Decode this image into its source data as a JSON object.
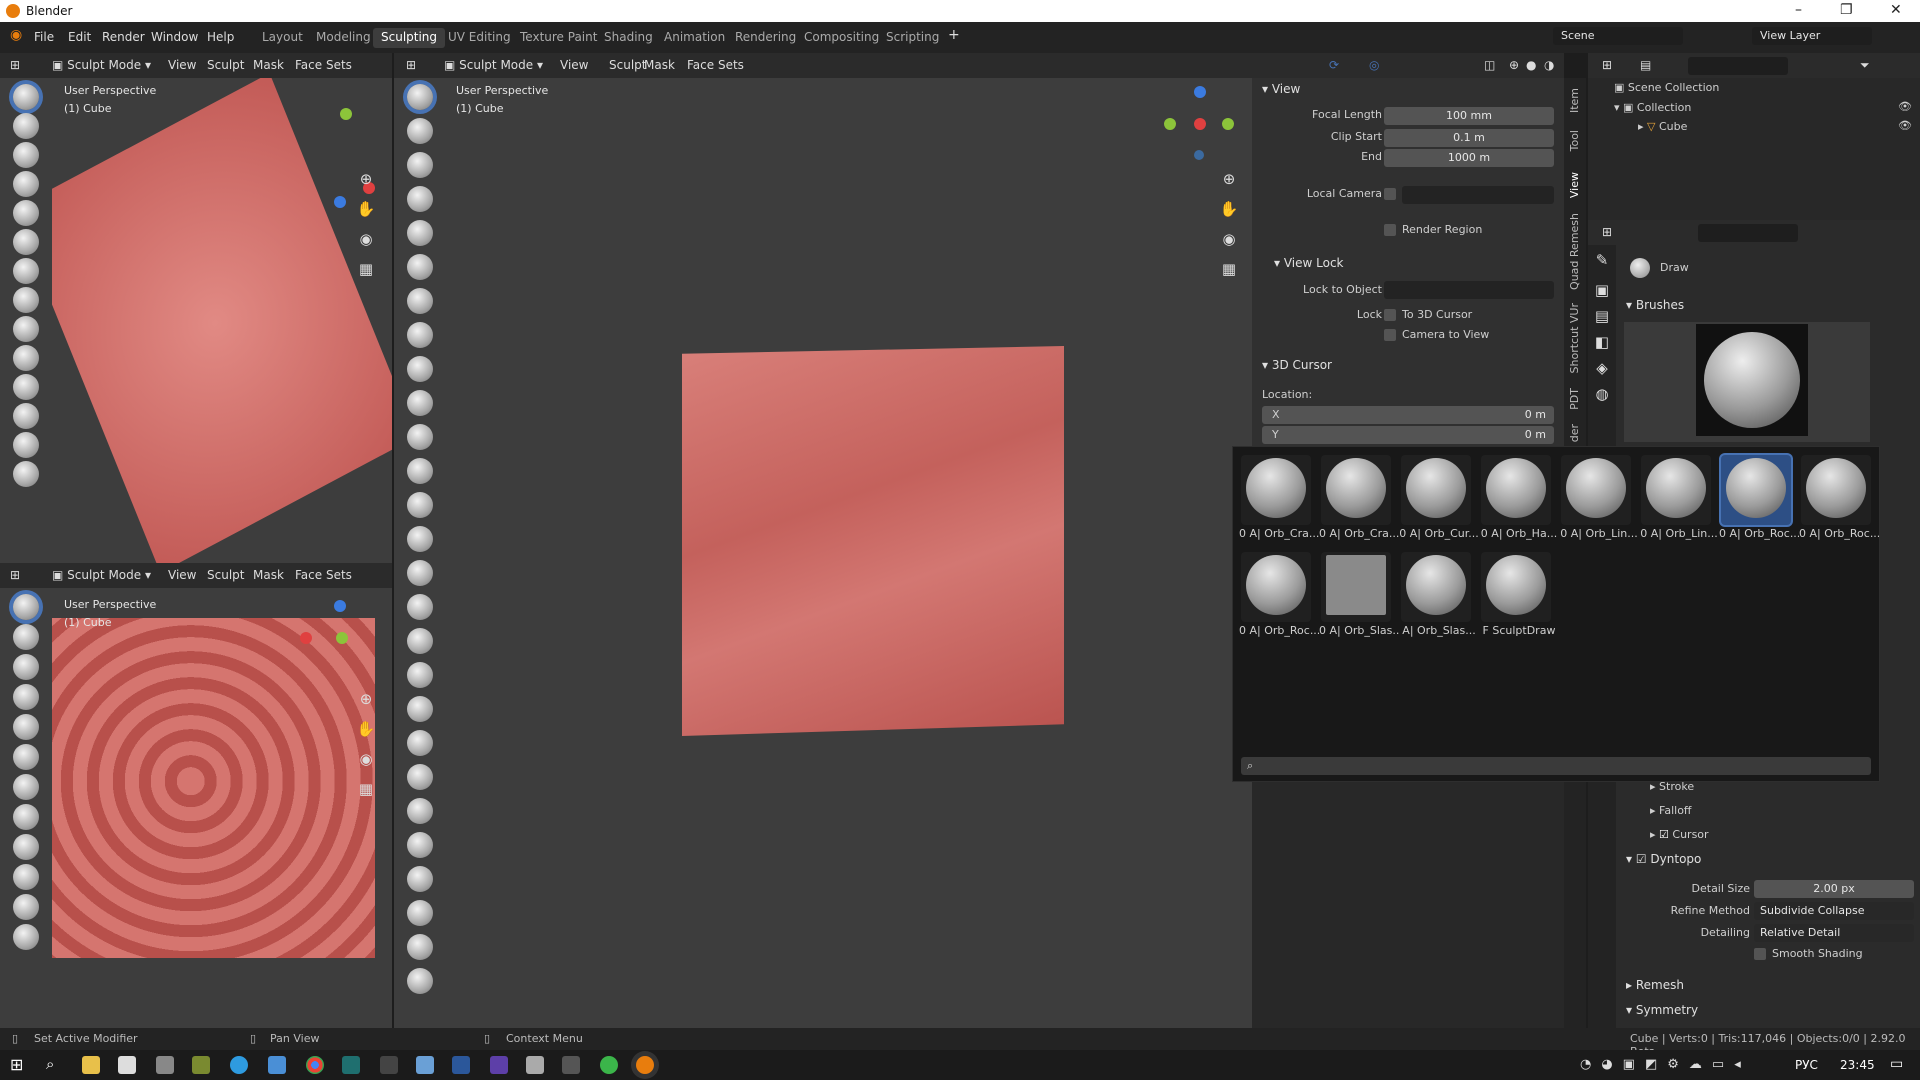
{
  "window": {
    "title": "Blender"
  },
  "menu": {
    "file": "File",
    "edit": "Edit",
    "render": "Render",
    "window": "Window",
    "help": "Help"
  },
  "workspaces": [
    "Layout",
    "Modeling",
    "Sculpting",
    "UV Editing",
    "Texture Paint",
    "Shading",
    "Animation",
    "Rendering",
    "Compositing",
    "Scripting"
  ],
  "scene": {
    "name": "Scene",
    "view_layer": "View Layer"
  },
  "viewport_header": {
    "mode": "Sculpt Mode",
    "view": "View",
    "sculpt": "Sculpt",
    "mask": "Mask",
    "face_sets": "Face Sets"
  },
  "viewports": [
    {
      "title": "User Perspective",
      "object": "(1) Cube"
    },
    {
      "title": "User Perspective",
      "object": "(1) Cube"
    },
    {
      "title": "User Perspective",
      "object": "(1) Cube"
    }
  ],
  "view_panel": {
    "section": "View",
    "focal_length_label": "Focal Length",
    "focal_length": "100 mm",
    "clip_start_label": "Clip Start",
    "clip_start": "0.1 m",
    "end_label": "End",
    "end": "1000 m",
    "local_camera_label": "Local Camera",
    "render_region": "Render Region",
    "view_lock_section": "View Lock",
    "lock_to_object_label": "Lock to Object",
    "lock_label": "Lock",
    "to_3d_cursor": "To 3D Cursor",
    "camera_to_view": "Camera to View",
    "cursor_section": "3D Cursor",
    "location_label": "Location:",
    "x_label": "X",
    "x_value": "0 m",
    "y_label": "Y",
    "y_value": "0 m"
  },
  "side_tabs": [
    "Item",
    "Tool",
    "View",
    "Quad Remesh",
    "Shortcut VUr",
    "PDT",
    "der"
  ],
  "outliner": {
    "scene_collection": "Scene Collection",
    "collection": "Collection",
    "cube": "Cube"
  },
  "properties": {
    "brush_name": "Draw",
    "brushes_section": "Brushes",
    "stroke": "Stroke",
    "falloff": "Falloff",
    "cursor": "Cursor",
    "dyntopo": "Dyntopo",
    "detail_size_label": "Detail Size",
    "detail_size": "2.00 px",
    "refine_method_label": "Refine Method",
    "refine_method": "Subdivide Collapse",
    "detailing_label": "Detailing",
    "detailing": "Relative Detail",
    "smooth_shading": "Smooth Shading",
    "remesh": "Remesh",
    "symmetry": "Symmetry"
  },
  "brush_popup": {
    "row1": [
      "0 A| Orb_Cra...",
      "0 A| Orb_Cra...",
      "0 A| Orb_Cur...",
      "0 A| Orb_Ha...",
      "0 A| Orb_Lin...",
      "0 A| Orb_Lin...",
      "0 A| Orb_Roc...",
      "0 A| Orb_Roc..."
    ],
    "row2": [
      "0 A| Orb_Roc...",
      "0 A| Orb_Slas...",
      "A| Orb_Slas...",
      "F SculptDraw"
    ],
    "search_placeholder": ""
  },
  "status": {
    "left": "Set Active Modifier",
    "middle": "Pan View",
    "context": "Context Menu",
    "right": "Cube | Verts:0 | Tris:117,046 | Objects:0/0 | 2.92.0 Beta"
  },
  "taskbar": {
    "lang": "РУС",
    "time": "23:45"
  },
  "axes": {
    "x": "X",
    "y": "Y",
    "z": "Z"
  },
  "colors": {
    "mesh": "#c8625e",
    "accent": "#4772b3"
  }
}
